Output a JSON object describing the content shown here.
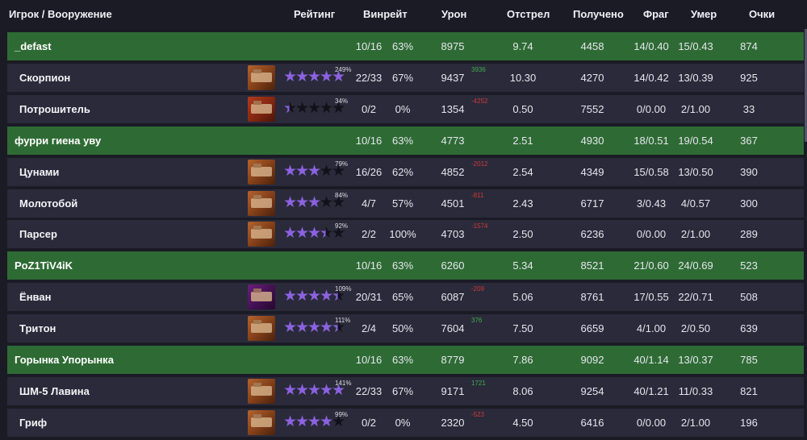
{
  "header": {
    "player": "Игрок / Вооружение",
    "rating": "Рейтинг",
    "winrate": "Винрейт",
    "damage": "Урон",
    "shots": "Отстрел",
    "received": "Получено",
    "frag": "Фраг",
    "died": "Умер",
    "points": "Очки"
  },
  "rows": [
    {
      "kind": "player",
      "name": "_defast",
      "games": "10/16",
      "winrate": "63%",
      "damage": "8975",
      "shots": "9.74",
      "received": "4458",
      "frag": "14/0.40",
      "died": "15/0.43",
      "points": "874"
    },
    {
      "kind": "weapon",
      "name": "Скорпион",
      "thumb": "orange",
      "stars": 5,
      "pct": "249%",
      "games": "22/33",
      "winrate": "67%",
      "damage": "9437",
      "delta": "3936",
      "delta_sign": "pos",
      "shots": "10.30",
      "received": "4270",
      "frag": "14/0.42",
      "died": "13/0.39",
      "points": "925"
    },
    {
      "kind": "weapon",
      "name": "Потрошитель",
      "thumb": "red",
      "stars": 0.5,
      "pct": "34%",
      "games": "0/2",
      "winrate": "0%",
      "damage": "1354",
      "delta": "-4252",
      "delta_sign": "neg",
      "shots": "0.50",
      "received": "7552",
      "frag": "0/0.00",
      "died": "2/1.00",
      "points": "33"
    },
    {
      "kind": "player",
      "name": "фурри гиена уву",
      "games": "10/16",
      "winrate": "63%",
      "damage": "4773",
      "shots": "2.51",
      "received": "4930",
      "frag": "18/0.51",
      "died": "19/0.54",
      "points": "367"
    },
    {
      "kind": "weapon",
      "name": "Цунами",
      "thumb": "orange",
      "stars": 3,
      "pct": "79%",
      "games": "16/26",
      "winrate": "62%",
      "damage": "4852",
      "delta": "-2012",
      "delta_sign": "neg",
      "shots": "2.54",
      "received": "4349",
      "frag": "15/0.58",
      "died": "13/0.50",
      "points": "390"
    },
    {
      "kind": "weapon",
      "name": "Молотобой",
      "thumb": "orange",
      "stars": 3,
      "pct": "84%",
      "games": "4/7",
      "winrate": "57%",
      "damage": "4501",
      "delta": "-811",
      "delta_sign": "neg",
      "shots": "2.43",
      "received": "6717",
      "frag": "3/0.43",
      "died": "4/0.57",
      "points": "300"
    },
    {
      "kind": "weapon",
      "name": "Парсер",
      "thumb": "orange",
      "stars": 3.5,
      "pct": "92%",
      "games": "2/2",
      "winrate": "100%",
      "damage": "4703",
      "delta": "-1574",
      "delta_sign": "neg",
      "shots": "2.50",
      "received": "6236",
      "frag": "0/0.00",
      "died": "2/1.00",
      "points": "289"
    },
    {
      "kind": "player",
      "name": "PoZ1TiV4iK",
      "games": "10/16",
      "winrate": "63%",
      "damage": "6260",
      "shots": "5.34",
      "received": "8521",
      "frag": "21/0.60",
      "died": "24/0.69",
      "points": "523"
    },
    {
      "kind": "weapon",
      "name": "Ёнван",
      "thumb": "purple",
      "stars": 4.5,
      "pct": "109%",
      "games": "20/31",
      "winrate": "65%",
      "damage": "6087",
      "delta": "-209",
      "delta_sign": "neg",
      "shots": "5.06",
      "received": "8761",
      "frag": "17/0.55",
      "died": "22/0.71",
      "points": "508"
    },
    {
      "kind": "weapon",
      "name": "Тритон",
      "thumb": "orange",
      "stars": 4.5,
      "pct": "111%",
      "games": "2/4",
      "winrate": "50%",
      "damage": "7604",
      "delta": "376",
      "delta_sign": "pos",
      "shots": "7.50",
      "received": "6659",
      "frag": "4/1.00",
      "died": "2/0.50",
      "points": "639"
    },
    {
      "kind": "player",
      "name": "Горынка Упорынка",
      "games": "10/16",
      "winrate": "63%",
      "damage": "8779",
      "shots": "7.86",
      "received": "9092",
      "frag": "40/1.14",
      "died": "13/0.37",
      "points": "785"
    },
    {
      "kind": "weapon",
      "name": "ШМ-5 Лавина",
      "thumb": "orange",
      "stars": 5,
      "pct": "141%",
      "games": "22/33",
      "winrate": "67%",
      "damage": "9171",
      "delta": "1721",
      "delta_sign": "pos",
      "shots": "8.06",
      "received": "9254",
      "frag": "40/1.21",
      "died": "11/0.33",
      "points": "821"
    },
    {
      "kind": "weapon",
      "name": "Гриф",
      "thumb": "orange",
      "stars": 4,
      "pct": "99%",
      "games": "0/2",
      "winrate": "0%",
      "damage": "2320",
      "delta": "-523",
      "delta_sign": "neg",
      "shots": "4.50",
      "received": "6416",
      "frag": "0/0.00",
      "died": "2/1.00",
      "points": "196"
    }
  ]
}
